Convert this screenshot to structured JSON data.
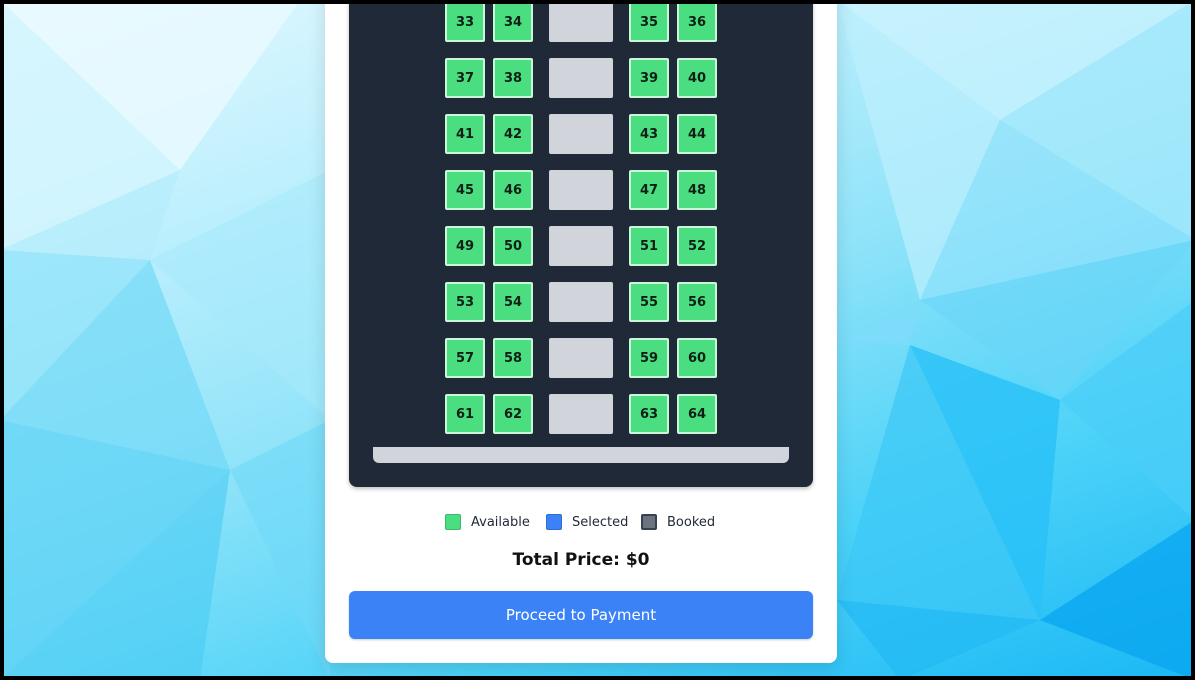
{
  "theme": {
    "available_color": "#4ade80",
    "selected_color": "#3b82f6",
    "booked_color": "#6b7280",
    "bus_color": "#1f2937",
    "aisle_color": "#d1d5db"
  },
  "seat_rows": [
    {
      "left": [
        "33",
        "34"
      ],
      "right": [
        "35",
        "36"
      ]
    },
    {
      "left": [
        "37",
        "38"
      ],
      "right": [
        "39",
        "40"
      ]
    },
    {
      "left": [
        "41",
        "42"
      ],
      "right": [
        "43",
        "44"
      ]
    },
    {
      "left": [
        "45",
        "46"
      ],
      "right": [
        "47",
        "48"
      ]
    },
    {
      "left": [
        "49",
        "50"
      ],
      "right": [
        "51",
        "52"
      ]
    },
    {
      "left": [
        "53",
        "54"
      ],
      "right": [
        "55",
        "56"
      ]
    },
    {
      "left": [
        "57",
        "58"
      ],
      "right": [
        "59",
        "60"
      ]
    },
    {
      "left": [
        "61",
        "62"
      ],
      "right": [
        "63",
        "64"
      ]
    }
  ],
  "legend": {
    "available": {
      "label": "Available",
      "color": "#4ade80"
    },
    "selected": {
      "label": "Selected",
      "color": "#3b82f6"
    },
    "booked": {
      "label": "Booked",
      "color": "#6b7280"
    }
  },
  "summary": {
    "total_text": "Total Price: $0"
  },
  "actions": {
    "proceed_label": "Proceed to Payment"
  }
}
